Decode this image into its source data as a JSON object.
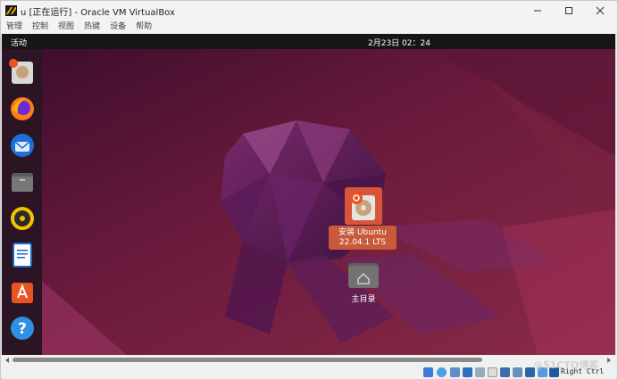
{
  "window": {
    "title": "u [正在运行] - Oracle VM VirtualBox"
  },
  "menu": [
    "管理",
    "控制",
    "视图",
    "热键",
    "设备",
    "帮助"
  ],
  "topbar": {
    "activities": "活动",
    "clock": "2月23日  02：24"
  },
  "dock": [
    "Ubuntu installer",
    "Firefox",
    "Thunderbird",
    "Files",
    "Rhythmbox",
    "LibreOffice Writer",
    "Ubuntu Software",
    "Help"
  ],
  "desktop": {
    "install_label_line1": "安装 Ubuntu",
    "install_label_line2": "22.04.1 LTS",
    "home_label": "主目录"
  },
  "status": {
    "host_key": "Right Ctrl"
  },
  "watermark": "@51CTO博客",
  "colors": {
    "accent": "#e95420",
    "desktop": "#5a1536"
  }
}
